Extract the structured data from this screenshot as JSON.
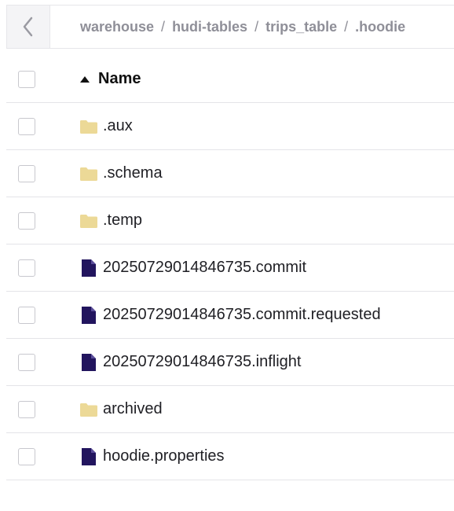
{
  "breadcrumb": {
    "parts": [
      "warehouse",
      "hudi-tables",
      "trips_table",
      ".hoodie"
    ],
    "separator": "/"
  },
  "table": {
    "header": {
      "name": "Name",
      "sort": "ascending"
    },
    "rows": [
      {
        "name": ".aux",
        "type": "folder"
      },
      {
        "name": ".schema",
        "type": "folder"
      },
      {
        "name": ".temp",
        "type": "folder"
      },
      {
        "name": "20250729014846735.commit",
        "type": "file"
      },
      {
        "name": "20250729014846735.commit.requested",
        "type": "file"
      },
      {
        "name": "20250729014846735.inflight",
        "type": "file"
      },
      {
        "name": "archived",
        "type": "folder"
      },
      {
        "name": "hoodie.properties",
        "type": "file"
      }
    ]
  },
  "colors": {
    "folder": "#ecd997",
    "file": "#22155e",
    "separator": "#e4e4e8"
  },
  "icons": {
    "back": "chevron-left-icon",
    "sort": "sort-ascending-icon",
    "folder": "folder-icon",
    "file": "file-icon"
  }
}
